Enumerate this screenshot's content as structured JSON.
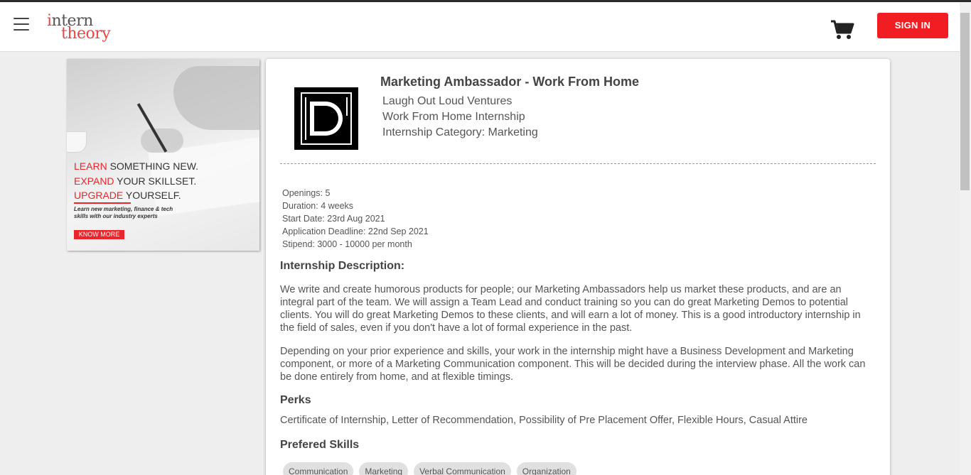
{
  "header": {
    "logo_line1_prefix": "i",
    "logo_line1_rest": "ntern",
    "logo_line2": "theory",
    "signin_label": "SIGN IN"
  },
  "ad": {
    "line1_red": "LEARN",
    "line1_rest": " SOMETHING NEW.",
    "line2_red": "EXPAND",
    "line2_rest": " YOUR SKILLSET.",
    "line3_red": "UPGRADE",
    "line3_rest": " YOURSELF.",
    "small1": "Learn new marketing, finance & tech",
    "small2": "skills with our industry experts",
    "button": "KNOW MORE"
  },
  "job": {
    "title": "Marketing Ambassador - Work From Home",
    "company": "Laugh Out Loud Ventures",
    "type": "Work From Home Internship",
    "category": "Internship Category: Marketing",
    "openings": "Openings: 5",
    "duration": "Duration: 4 weeks",
    "start_date": "Start Date: 23rd Aug 2021",
    "deadline": "Application Deadline: 22nd Sep 2021",
    "stipend": "Stipend: 3000 - 10000 per month"
  },
  "description": {
    "title": "Internship Description:",
    "para1": "We write and create humorous products for people; our Marketing Ambassadors help us market these products, and are an integral part of the team. We will assign a Team Lead and conduct training so you can do great Marketing Demos to potential clients. You will do great Marketing Demos to these clients, and will earn a lot of money. This is a good introductory internship in the field of sales, even if you don't have a lot of formal experience in the past.",
    "para2": "Depending on your prior experience and skills, your work in the internship might have a Business Development and Marketing component, or more of a Marketing Communication component. This will be decided during the interview phase. All the work can be done entirely from home, and at flexible timings."
  },
  "perks": {
    "title": "Perks",
    "text": "Certificate of Internship, Letter of Recommendation, Possibility of Pre Placement Offer, Flexible Hours, Casual Attire"
  },
  "skills": {
    "title": "Prefered Skills",
    "items": [
      "Communication",
      "Marketing",
      "Verbal Communication",
      "Organization"
    ]
  },
  "colors": {
    "accent": "#f21d22",
    "background": "#efeeee"
  },
  "icons": {
    "menu": "hamburger-icon",
    "cart": "cart-icon"
  }
}
